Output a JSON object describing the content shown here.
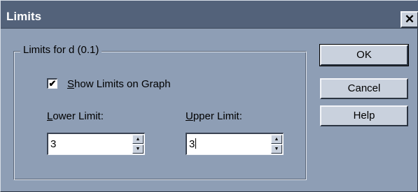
{
  "window": {
    "title": "Limits",
    "close_glyph": "✕",
    "close_icon": "close-icon"
  },
  "group": {
    "legend": "Limits for d (0.1)"
  },
  "show_limits": {
    "label_mnemonic": "S",
    "label_rest": "how Limits on Graph",
    "checked": true,
    "check_glyph": "✔"
  },
  "lower_limit": {
    "label_mnemonic": "L",
    "label_rest": "ower Limit:",
    "value": "3"
  },
  "upper_limit": {
    "label_mnemonic": "U",
    "label_rest": "pper Limit:",
    "value": "3"
  },
  "spinner": {
    "up_glyph": "▲",
    "down_glyph": "▼"
  },
  "buttons": {
    "ok": "OK",
    "cancel": "Cancel",
    "help": "Help"
  }
}
